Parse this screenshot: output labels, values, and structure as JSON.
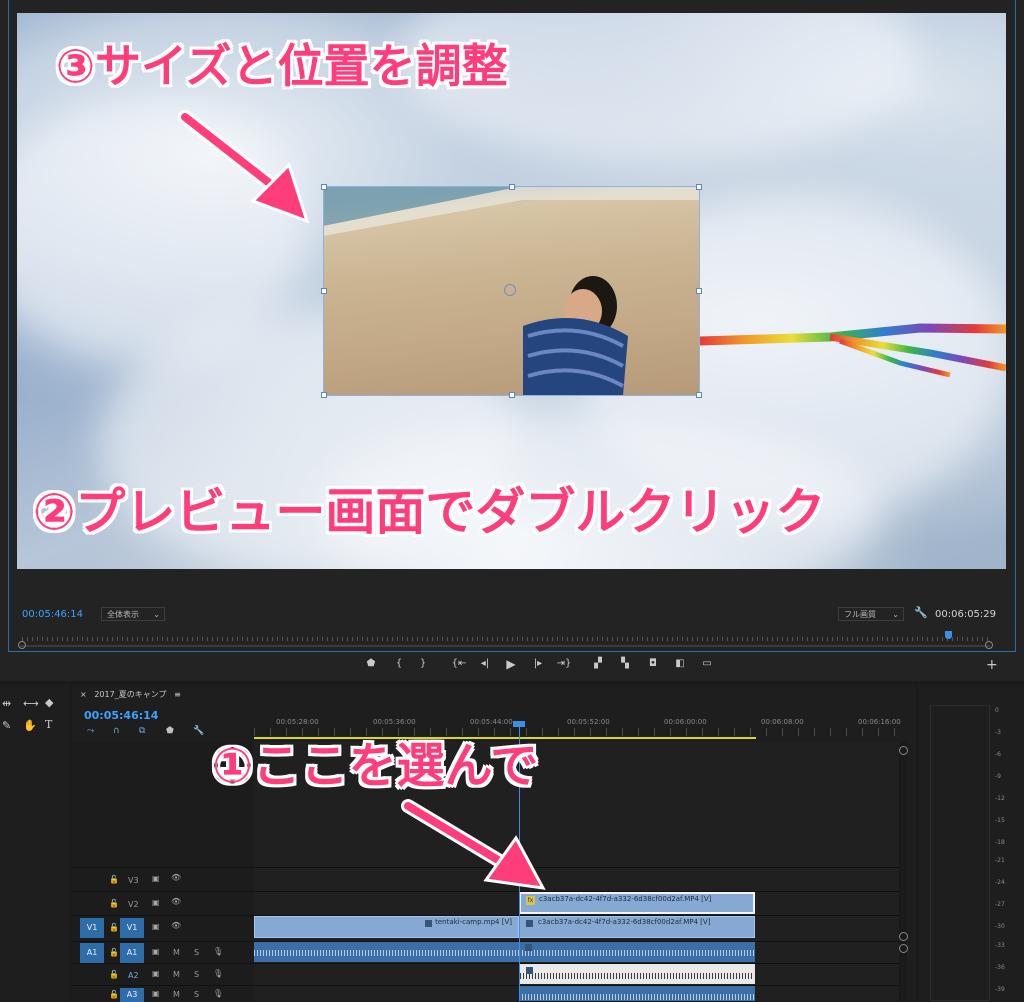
{
  "annotations": {
    "step3": "③サイズと位置を調整",
    "step2": "②プレビュー画面でダブルクリック",
    "step1": "①ここを選んで"
  },
  "monitor": {
    "timecode_left": "00:05:46:14",
    "fit_select": "全体表示",
    "quality_select": "フル画質",
    "timecode_right": "00:06:05:29"
  },
  "timeline": {
    "sequence_tab": "2017_夏のキャンプ",
    "timecode": "00:05:46:14",
    "ruler_labels": [
      "00:05:28:00",
      "00:05:36:00",
      "00:05:44:00",
      "00:05:52:00",
      "00:06:00:00",
      "00:06:08:00",
      "00:06:16:00"
    ],
    "tracks": {
      "v3": "V3",
      "v2": "V2",
      "v1": "V1",
      "v1_source": "V1",
      "a1": "A1",
      "a1_source": "A1",
      "a2": "A2",
      "a3": "A3",
      "mute": "M",
      "solo": "S"
    },
    "clips": {
      "v2_clip": "c3acb37a-dc42-4f7d-a332-6d38cf00d2af.MP4 [V]",
      "v1_clip_a": "tentaki-camp.mp4 [V]",
      "v1_clip_b": "c3acb37a-dc42-4f7d-a332-6d38cf00d2af.MP4 [V]"
    }
  },
  "meters": {
    "labels": [
      "0",
      "-3",
      "-6",
      "-9",
      "-12",
      "-15",
      "-18",
      "-21",
      "-24",
      "-27",
      "-30",
      "-33",
      "-36",
      "-39"
    ]
  },
  "colors": {
    "accent": "#3ca3ff",
    "annotation": "#ff3d7b",
    "clip_video": "#86a9d3",
    "clip_audio": "#3b6fa6",
    "work_area": "#d9d91a"
  }
}
